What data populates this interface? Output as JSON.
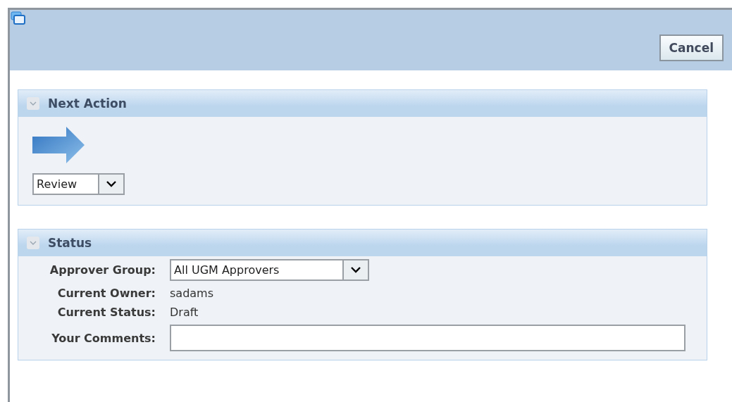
{
  "toolbar": {
    "buttons": [
      "Cancel"
    ]
  },
  "sections": [
    {
      "title": "Next Action",
      "expanded": true,
      "action_select": {
        "value": "Review"
      }
    },
    {
      "title": "Status",
      "expanded": true,
      "fields": [
        {
          "kind": "select",
          "label": "Approver Group:",
          "value": "All UGM Approvers"
        },
        {
          "kind": "text",
          "label": "Current Owner:",
          "value": "sadams"
        },
        {
          "kind": "text",
          "label": "Current Status:",
          "value": "Draft"
        },
        {
          "kind": "input",
          "label": "Your Comments:"
        }
      ]
    }
  ]
}
